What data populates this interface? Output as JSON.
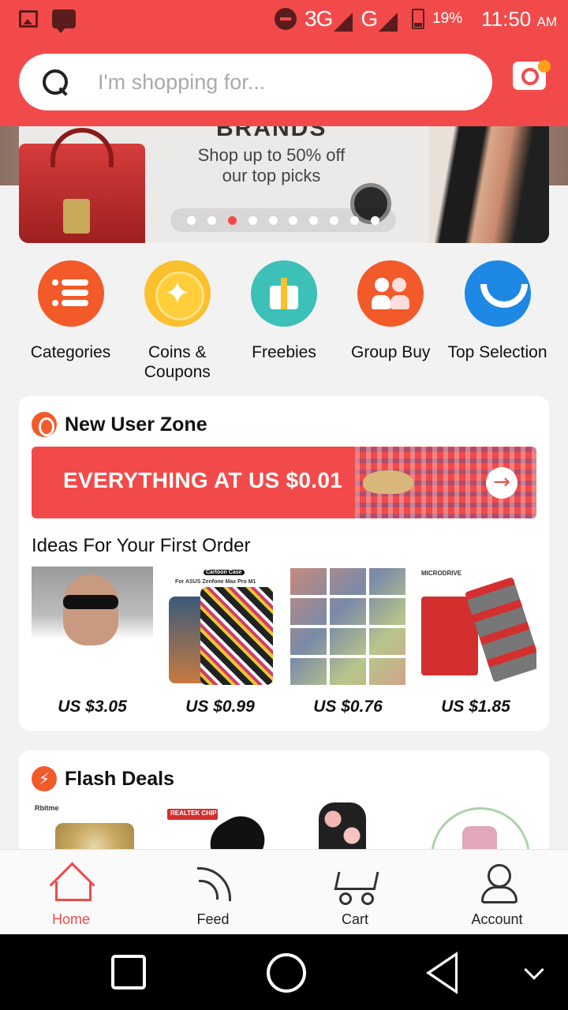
{
  "status_bar": {
    "network_1": "3G",
    "network_2": "G",
    "battery": "19%",
    "time": "11:50",
    "ampm": "AM"
  },
  "search": {
    "placeholder": "I'm shopping for..."
  },
  "banner": {
    "heading": "BRANDS",
    "line1": "Shop up to 50% off",
    "line2": "our top picks",
    "dot_count": 10,
    "active_dot": 3
  },
  "quick_links": [
    {
      "label": "Categories",
      "icon": "categories-icon"
    },
    {
      "label": "Coins & Coupons",
      "icon": "coins-icon"
    },
    {
      "label": "Freebies",
      "icon": "gift-icon"
    },
    {
      "label": "Group Buy",
      "icon": "group-icon"
    },
    {
      "label": "Top Selection",
      "icon": "smile-icon"
    }
  ],
  "new_user_zone": {
    "title": "New User Zone",
    "banner_text": "EVERYTHING AT US $0.01",
    "ideas_title": "Ideas For Your First Order",
    "products": [
      {
        "price": "US $3.05"
      },
      {
        "price": "US $0.99",
        "tag1": "Cartoon Case",
        "tag2": "For ASUS Zenfone Max Pro M1"
      },
      {
        "price": "US $0.76"
      },
      {
        "price": "US $1.85",
        "tag1": "MICRODRIVE"
      }
    ]
  },
  "flash_deals": {
    "title": "Flash Deals",
    "tag1": "Rbitme",
    "tag2": "REALTEK CHIP"
  },
  "bottom_nav": [
    {
      "label": "Home",
      "active": true
    },
    {
      "label": "Feed",
      "active": false
    },
    {
      "label": "Cart",
      "active": false
    },
    {
      "label": "Account",
      "active": false
    }
  ],
  "colors": {
    "brand": "#f24a4a",
    "accent": "#f25a2a"
  }
}
